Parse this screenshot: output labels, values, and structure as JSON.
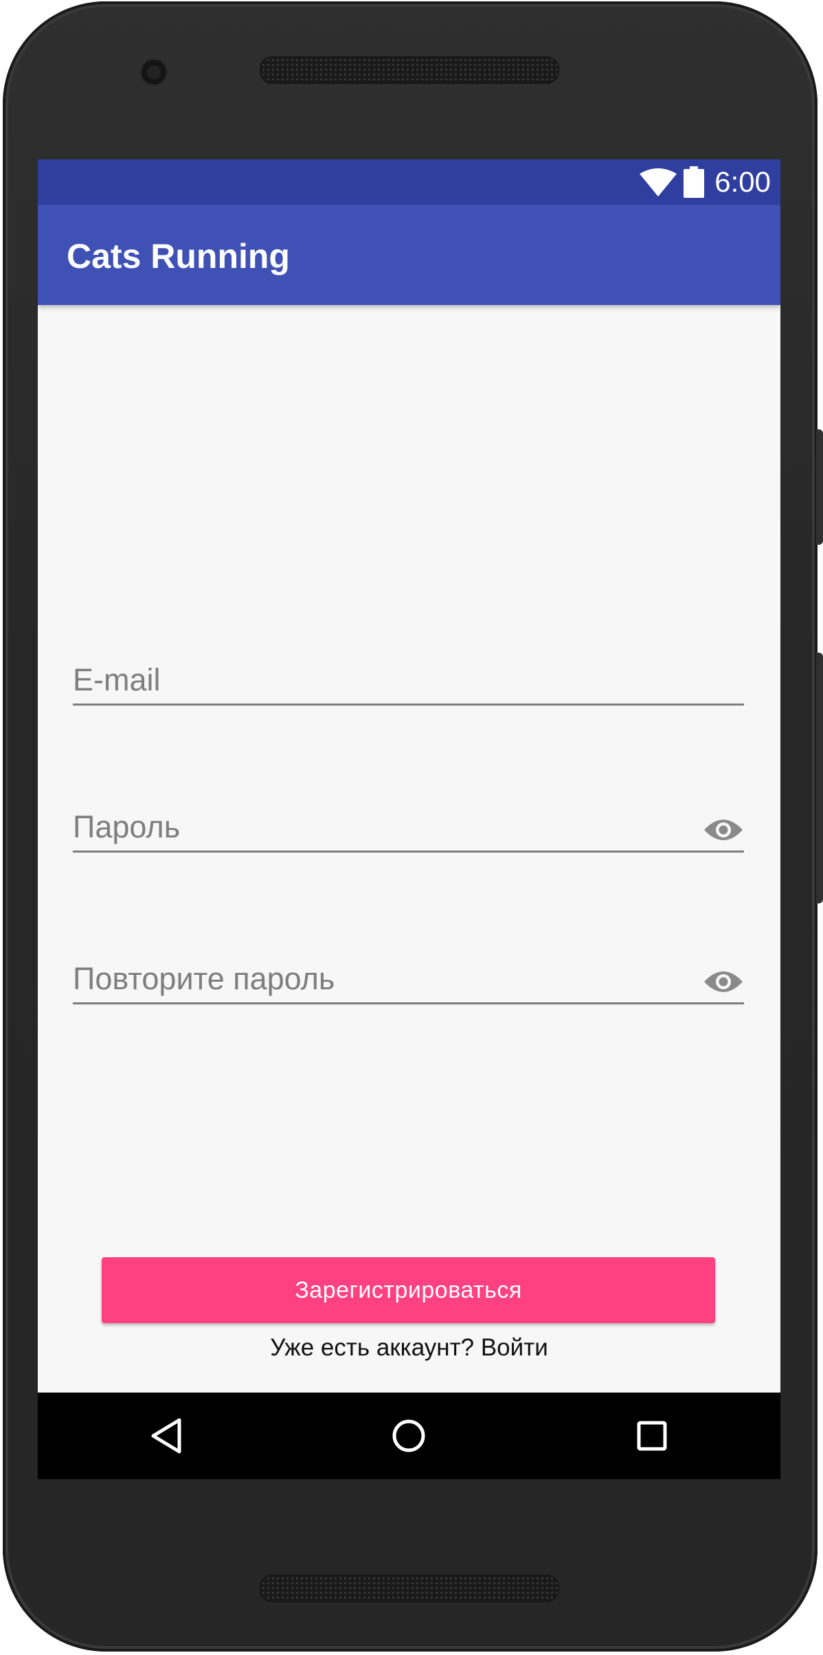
{
  "status_bar": {
    "time": "6:00",
    "wifi_icon": "wifi-icon",
    "battery_icon": "battery-icon"
  },
  "app_bar": {
    "title": "Cats Running"
  },
  "form": {
    "email_placeholder": "E-mail",
    "password_placeholder": "Пароль",
    "repeat_password_placeholder": "Повторите пароль",
    "visibility_icon": "eye-icon"
  },
  "actions": {
    "register_label": "Зарегистрироваться",
    "login_prompt": "Уже есть аккаунт? Войти"
  },
  "nav_bar": {
    "back_icon": "back-triangle-icon",
    "home_icon": "home-circle-icon",
    "recents_icon": "recents-square-icon"
  },
  "colors": {
    "status_bar": "#303f9f",
    "app_bar": "#3f51b5",
    "accent": "#ff4081",
    "screen_background": "#f7f7f7"
  }
}
